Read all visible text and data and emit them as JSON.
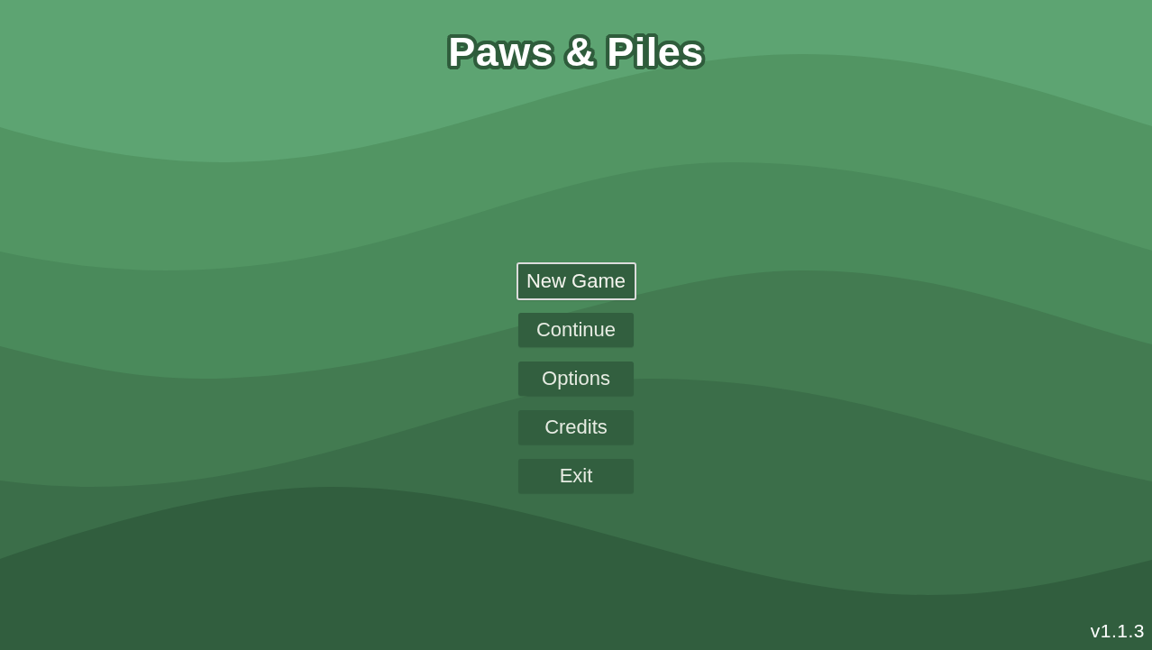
{
  "title": "Paws & Piles",
  "menu": [
    {
      "label": "New Game",
      "selected": true
    },
    {
      "label": "Continue",
      "selected": false
    },
    {
      "label": "Options",
      "selected": false
    },
    {
      "label": "Credits",
      "selected": false
    },
    {
      "label": "Exit",
      "selected": false
    }
  ],
  "version": "v1.1.3"
}
